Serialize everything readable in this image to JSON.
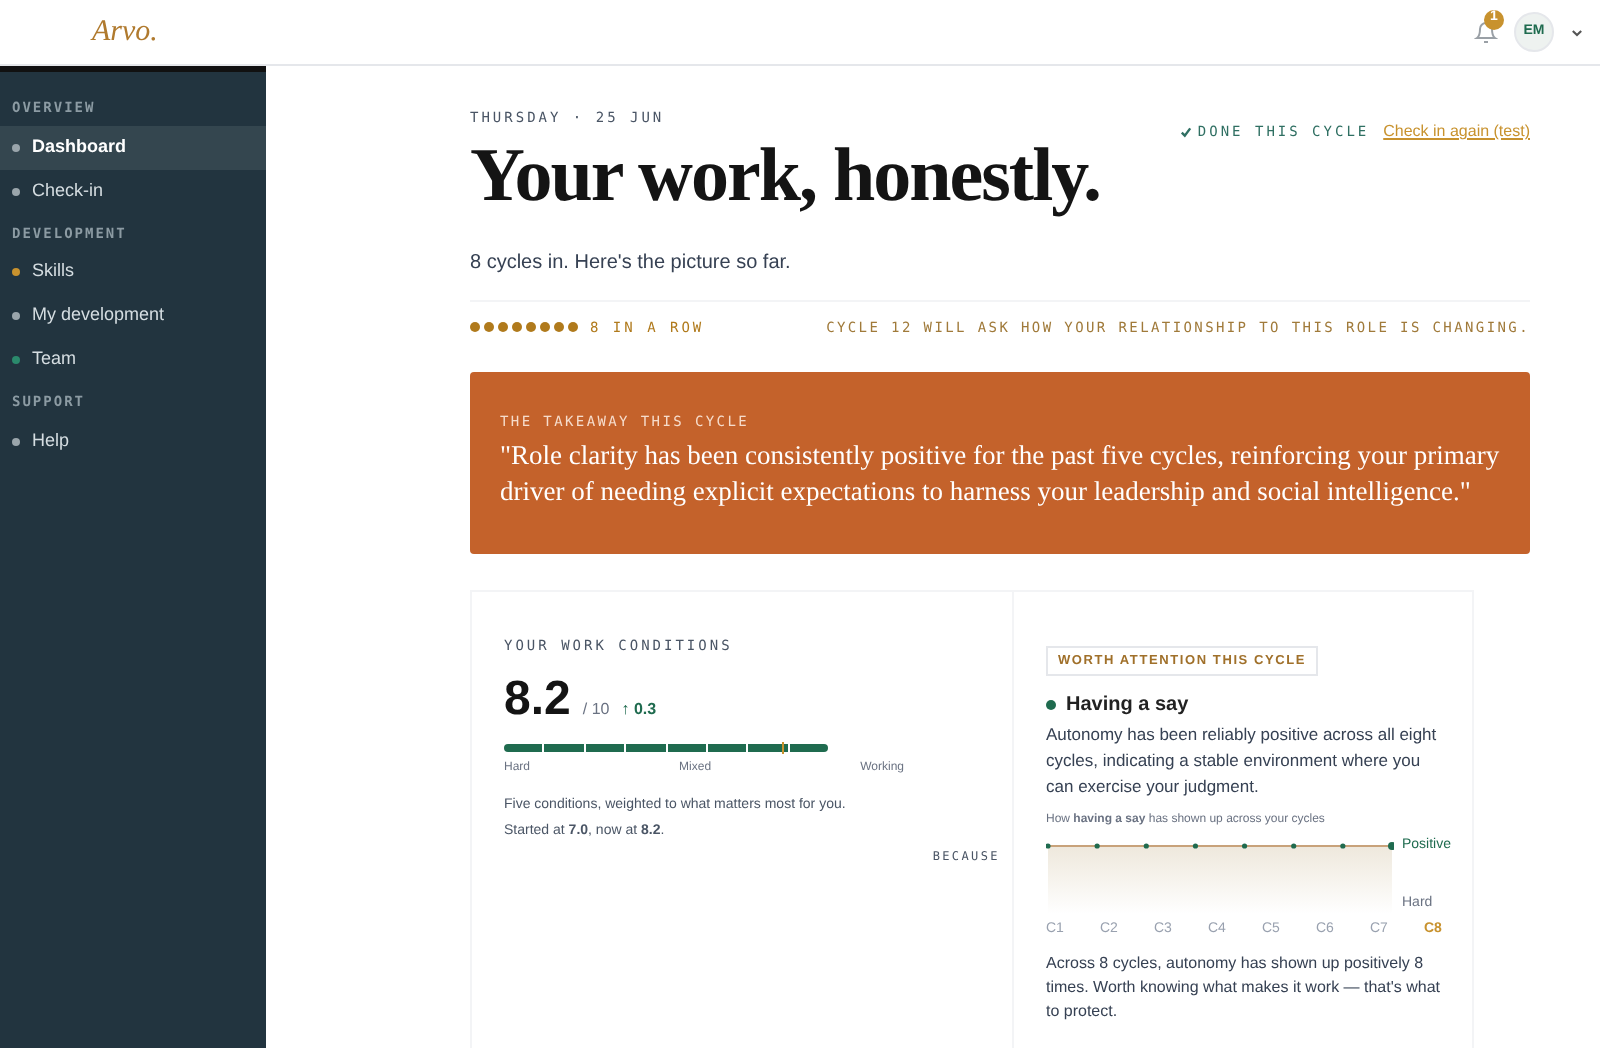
{
  "header": {
    "logo": "Arvo.",
    "notifications": {
      "count": "1"
    },
    "avatar": {
      "initials": "EM"
    }
  },
  "sidebar": {
    "sections": [
      {
        "title": "OVERVIEW",
        "items": [
          {
            "label": "Dashboard",
            "selected": true,
            "color": "#9aa5ab"
          },
          {
            "label": "Check-in",
            "selected": false,
            "color": "#9aa5ab"
          }
        ]
      },
      {
        "title": "DEVELOPMENT",
        "items": [
          {
            "label": "Skills",
            "selected": false,
            "color": "#c8922e"
          },
          {
            "label": "My development",
            "selected": false,
            "color": "#9aa5ab"
          },
          {
            "label": "Team",
            "selected": false,
            "color": "#2b8a6c"
          }
        ]
      },
      {
        "title": "SUPPORT",
        "items": [
          {
            "label": "Help",
            "selected": false,
            "color": "#9aa5ab"
          }
        ]
      }
    ]
  },
  "date": "THURSDAY · 25 JUN",
  "status": {
    "label": "DONE THIS CYCLE",
    "done": true,
    "link": "Check in again (test)"
  },
  "title": "Your work, honestly.",
  "subtitle": "8 cycles in. Here's the picture so far.",
  "streak": {
    "dots": [
      {
        "filled": true
      },
      {
        "filled": true
      },
      {
        "filled": true
      },
      {
        "filled": true
      },
      {
        "filled": true
      },
      {
        "filled": true
      },
      {
        "filled": true
      },
      {
        "filled": true
      }
    ],
    "label": "8 IN A ROW",
    "note": "CYCLE 12 WILL ASK HOW YOUR RELATIONSHIP TO THIS ROLE IS CHANGING."
  },
  "takeaway": {
    "label": "THE TAKEAWAY THIS CYCLE",
    "quote": "\"Role clarity has been consistently positive for the past five cycles, reinforcing your primary driver of needing explicit expectations to harness your leadership and social intelligence.\""
  },
  "conditions": {
    "label": "YOUR WORK CONDITIONS",
    "score": "8.2",
    "out_of": "/ 10",
    "change": "↑ 0.3",
    "level": 0.86,
    "scale": [
      "Hard",
      "Mixed",
      "Working"
    ],
    "description": "Five conditions, weighted to what matters most for you.",
    "history": "Started at **7.0**, now at **8.2**.",
    "because": "BECAUSE"
  },
  "attention": {
    "badge": "WORTH ATTENTION THIS CYCLE",
    "title": "Having a say",
    "color": "#1f6b4f",
    "text": "Autonomy has been reliably positive across all eight cycles, indicating a stable environment where you can exercise your judgment.",
    "chart_caption": "How **having a say** has shown up across your cycles",
    "trend": {
      "categories": [
        "C1",
        "C2",
        "C3",
        "C4",
        "C5",
        "C6",
        "C7",
        "C8"
      ],
      "axis_labels": [
        "Positive",
        "Hard"
      ]
    },
    "summary": "Across 8 cycles, autonomy has shown up positively 8 times. Worth knowing what makes it work — that's what to protect."
  }
}
